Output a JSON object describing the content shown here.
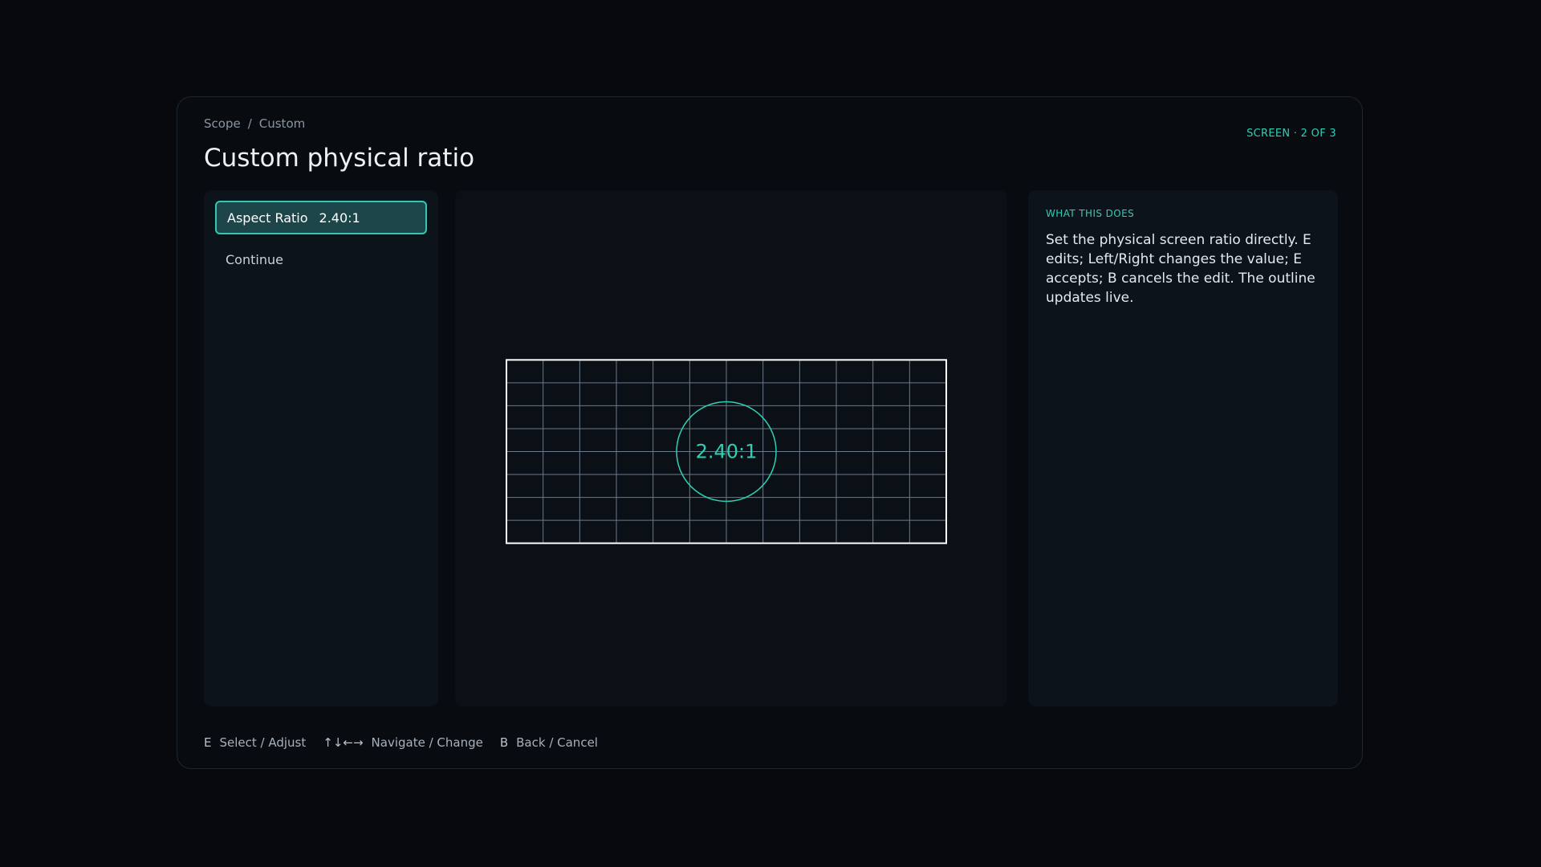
{
  "breadcrumb": {
    "items": [
      "Scope",
      "Custom"
    ],
    "separator": "/"
  },
  "page": {
    "title": "Custom physical ratio",
    "screen_counter": "SCREEN · 2 OF 3"
  },
  "menu": {
    "items": [
      {
        "label": "Aspect Ratio",
        "value": "2.40:1",
        "selected": true
      },
      {
        "label": "Continue",
        "selected": false
      }
    ]
  },
  "preview": {
    "ratio_label": "2.40:1",
    "aspect_ratio": 2.4,
    "grid_columns": 12,
    "grid_rows": 8,
    "outline_color": "#ffffff",
    "grid_color": "#6b7a8c",
    "accent_color": "#2fcfb4"
  },
  "info": {
    "heading": "WHAT THIS DOES",
    "body": "Set the physical screen ratio directly. E edits; Left/Right changes the value; E accepts; B cancels the edit. The outline updates live."
  },
  "footer": {
    "hints": [
      {
        "key": "E",
        "label": "Select / Adjust"
      },
      {
        "key": "↑↓←→",
        "label": "Navigate / Change"
      },
      {
        "key": "B",
        "label": "Back / Cancel"
      }
    ]
  },
  "colors": {
    "background": "#07090d",
    "accent": "#2fcfb4",
    "selected_fill": "#1c4649"
  }
}
